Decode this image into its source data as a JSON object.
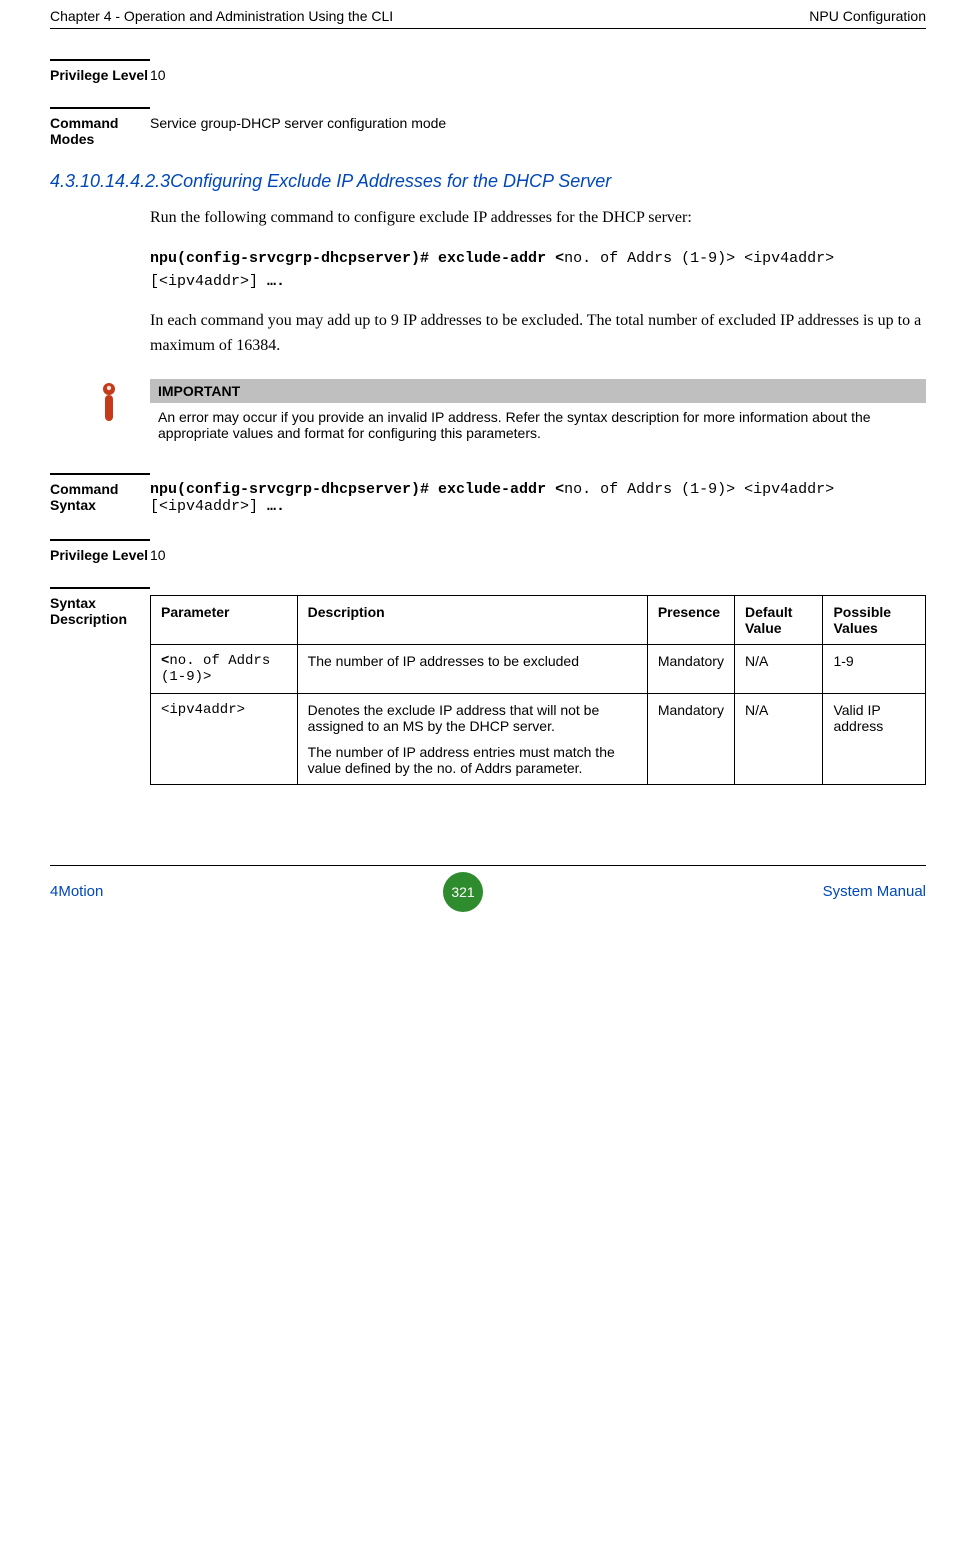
{
  "header": {
    "left": "Chapter 4 - Operation and Administration Using the CLI",
    "right": "NPU Configuration"
  },
  "privilege1": {
    "label": "Privilege Level",
    "value": "10"
  },
  "command_modes": {
    "label": "Command Modes",
    "value": "Service group-DHCP server configuration mode"
  },
  "subheading": {
    "num": "4.3.10.14.4.2.3",
    "title": "Configuring Exclude IP Addresses for the DHCP Server"
  },
  "para1": "Run the following command to configure exclude IP addresses for the DHCP server:",
  "cmd1_bold1": "npu(config-srvcgrp-dhcpserver)# exclude-addr <",
  "cmd1_plain1": "no. of Addrs (1-9)> <ipv4addr> [<ipv4addr>] ",
  "cmd1_bold2": "….",
  "para2": "In each command you may add up to 9 IP addresses to be excluded. The total number of excluded IP addresses is up to a maximum of 16384.",
  "important": {
    "header": "IMPORTANT",
    "body": "An error may occur if you provide an invalid IP address. Refer the syntax description for more information about the appropriate values and format for configuring this parameters."
  },
  "command_syntax": {
    "label": "Command Syntax",
    "bold1": "npu(config-srvcgrp-dhcpserver)# exclude-addr <",
    "plain1": "no. of Addrs (1-9)> <ipv4addr> [<ipv4addr>] ",
    "bold2": "…."
  },
  "privilege2": {
    "label": "Privilege Level",
    "value": "10"
  },
  "syntax_desc_label": "Syntax Description",
  "table": {
    "headers": {
      "c1": "Parameter",
      "c2": "Description",
      "c3": "Presence",
      "c4": "Default Value",
      "c5": "Possible Values"
    },
    "rows": [
      {
        "c1_bold": "<",
        "c1_rest": "no. of Addrs (1-9)>",
        "c2a": "The number of IP addresses to be excluded",
        "c2b": "",
        "c3": "Mandatory",
        "c4": "N/A",
        "c5": "1-9"
      },
      {
        "c1_bold": "",
        "c1_rest": "<ipv4addr>",
        "c2a": "Denotes the exclude IP address that will not be assigned to an MS by the DHCP server.",
        "c2b": "The number of IP address entries must match the value defined by the no. of Addrs parameter.",
        "c3": "Mandatory",
        "c4": "N/A",
        "c5": "Valid IP address"
      }
    ]
  },
  "footer": {
    "left": "4Motion",
    "page": "321",
    "right": "System Manual"
  }
}
